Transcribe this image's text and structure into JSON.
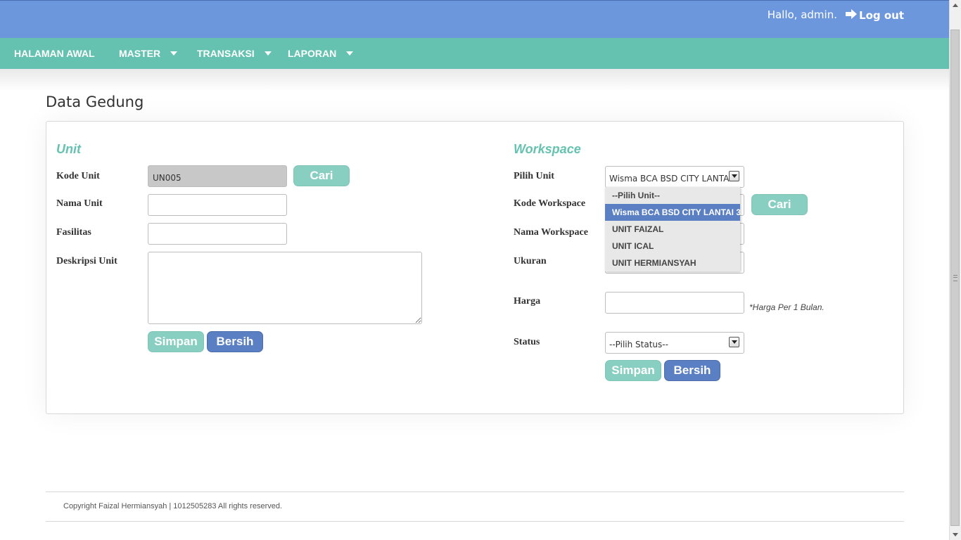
{
  "header": {
    "greeting": "Hallo, admin.",
    "logout_label": "Log out"
  },
  "nav": {
    "items": [
      {
        "label": "HALAMAN AWAL",
        "has_caret": false
      },
      {
        "label": "MASTER",
        "has_caret": true
      },
      {
        "label": "TRANSAKSI",
        "has_caret": true
      },
      {
        "label": "LAPORAN",
        "has_caret": true
      }
    ]
  },
  "page": {
    "title": "Data Gedung"
  },
  "unit_form": {
    "section_title": "Unit",
    "kode_unit_label": "Kode Unit",
    "kode_unit_value": "UN005",
    "cari_label": "Cari",
    "nama_unit_label": "Nama Unit",
    "nama_unit_value": "",
    "fasilitas_label": "Fasilitas",
    "fasilitas_value": "",
    "deskripsi_label": "Deskripsi Unit",
    "deskripsi_value": "",
    "simpan_label": "Simpan",
    "bersih_label": "Bersih"
  },
  "workspace_form": {
    "section_title": "Workspace",
    "pilih_unit_label": "Pilih Unit",
    "pilih_unit_value": "Wisma BCA BSD CITY LANTAI 3",
    "pilih_unit_options": [
      "--Pilih Unit--",
      "Wisma BCA BSD CITY LANTAI 3",
      "UNIT FAIZAL",
      "UNIT ICAL",
      "UNIT HERMIANSYAH"
    ],
    "selected_option_index": 1,
    "kode_workspace_label": "Kode Workspace",
    "cari_label": "Cari",
    "nama_workspace_label": "Nama Workspace",
    "ukuran_label": "Ukuran",
    "harga_label": "Harga",
    "harga_value": "",
    "harga_note": "*Harga Per 1 Bulan.",
    "status_label": "Status",
    "status_value": "--Pilih Status--",
    "simpan_label": "Simpan",
    "bersih_label": "Bersih"
  },
  "footer": {
    "copyright": "Copyright Faizal Hermiansyah | 1012505283 All rights reserved."
  },
  "colors": {
    "header_bg": "#6d97dc",
    "nav_bg": "#66c2b0",
    "accent_teal": "#66c2b0",
    "button_teal": "#88cfc2",
    "button_blue": "#5a7fc2"
  }
}
